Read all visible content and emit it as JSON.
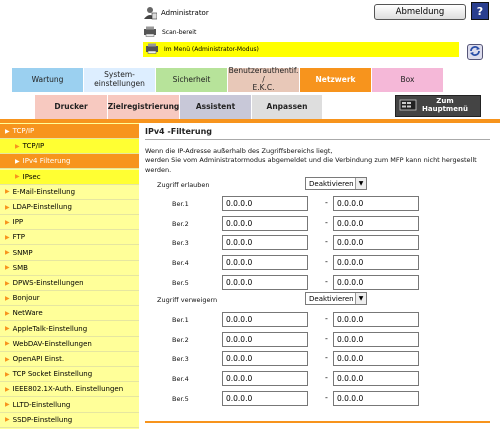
{
  "header": {
    "user_label": "Administrator",
    "logout_label": "Abmeldung",
    "help_label": "?",
    "status_scan": "Scan-bereit",
    "status_mode": "Im Menü (Administrator-Modus)"
  },
  "tabs_row1": [
    {
      "label": "Wartung",
      "color": "#9bd0f0"
    },
    {
      "label": "System-\neinstellungen",
      "color": "#ddeeff"
    },
    {
      "label": "Sicherheit",
      "color": "#b7e39a"
    },
    {
      "label": "Benutzerauthentif. /\nE.K.C.",
      "color": "#e8c8b8"
    },
    {
      "label": "Netzwerk",
      "color": "#f7941d"
    },
    {
      "label": "Box",
      "color": "#f5b8d8"
    }
  ],
  "tabs_row2": [
    {
      "label": "Drucker",
      "color": "#f7c9c0"
    },
    {
      "label": "Zielregistrierung",
      "color": "#f7c9c0"
    },
    {
      "label": "Assistent",
      "color": "#c8c8d8"
    },
    {
      "label": "Anpassen",
      "color": "#dedede"
    }
  ],
  "home_button": "Zum\nHauptmenü",
  "sidebar": [
    {
      "label": "TCP/IP",
      "level": 0,
      "state": "selected"
    },
    {
      "label": "TCP/IP",
      "level": 1,
      "state": "sub"
    },
    {
      "label": "IPv4 Filterung",
      "level": 1,
      "state": "selected"
    },
    {
      "label": "IPsec",
      "level": 1,
      "state": "sub"
    },
    {
      "label": "E-Mail-Einstellung",
      "level": 0,
      "state": ""
    },
    {
      "label": "LDAP-Einstellung",
      "level": 0,
      "state": ""
    },
    {
      "label": "IPP",
      "level": 0,
      "state": ""
    },
    {
      "label": "FTP",
      "level": 0,
      "state": ""
    },
    {
      "label": "SNMP",
      "level": 0,
      "state": ""
    },
    {
      "label": "SMB",
      "level": 0,
      "state": ""
    },
    {
      "label": "DPWS-Einstellungen",
      "level": 0,
      "state": ""
    },
    {
      "label": "Bonjour",
      "level": 0,
      "state": ""
    },
    {
      "label": "NetWare",
      "level": 0,
      "state": ""
    },
    {
      "label": "AppleTalk-Einstellung",
      "level": 0,
      "state": ""
    },
    {
      "label": "WebDAV-Einstellungen",
      "level": 0,
      "state": ""
    },
    {
      "label": "OpenAPI Einst.",
      "level": 0,
      "state": ""
    },
    {
      "label": "TCP Socket Einstellung",
      "level": 0,
      "state": ""
    },
    {
      "label": "IEEE802.1X-Auth. Einstellungen",
      "level": 0,
      "state": ""
    },
    {
      "label": "LLTD-Einstellung",
      "level": 0,
      "state": ""
    },
    {
      "label": "SSDP-Einstellung",
      "level": 0,
      "state": ""
    }
  ],
  "main": {
    "title": "IPv4 -Filterung",
    "message_line1": "Wenn die IP-Adresse außerhalb des Zugriffsbereichs liegt,",
    "message_line2": "werden Sie vom Administratormodus abgemeldet und die Verbindung zum MFP kann nicht hergestellt werden.",
    "allow": {
      "label": "Zugriff erlauben",
      "value": "Deaktivieren",
      "ranges": [
        {
          "label": "Ber.1",
          "from": "0.0.0.0",
          "to": "0.0.0.0"
        },
        {
          "label": "Ber.2",
          "from": "0.0.0.0",
          "to": "0.0.0.0"
        },
        {
          "label": "Ber.3",
          "from": "0.0.0.0",
          "to": "0.0.0.0"
        },
        {
          "label": "Ber.4",
          "from": "0.0.0.0",
          "to": "0.0.0.0"
        },
        {
          "label": "Ber.5",
          "from": "0.0.0.0",
          "to": "0.0.0.0"
        }
      ]
    },
    "deny": {
      "label": "Zugriff verweigern",
      "value": "Deaktivieren",
      "ranges": [
        {
          "label": "Ber.1",
          "from": "0.0.0.0",
          "to": "0.0.0.0"
        },
        {
          "label": "Ber.2",
          "from": "0.0.0.0",
          "to": "0.0.0.0"
        },
        {
          "label": "Ber.3",
          "from": "0.0.0.0",
          "to": "0.0.0.0"
        },
        {
          "label": "Ber.4",
          "from": "0.0.0.0",
          "to": "0.0.0.0"
        },
        {
          "label": "Ber.5",
          "from": "0.0.0.0",
          "to": "0.0.0.0"
        }
      ]
    },
    "range_separator": "-"
  }
}
